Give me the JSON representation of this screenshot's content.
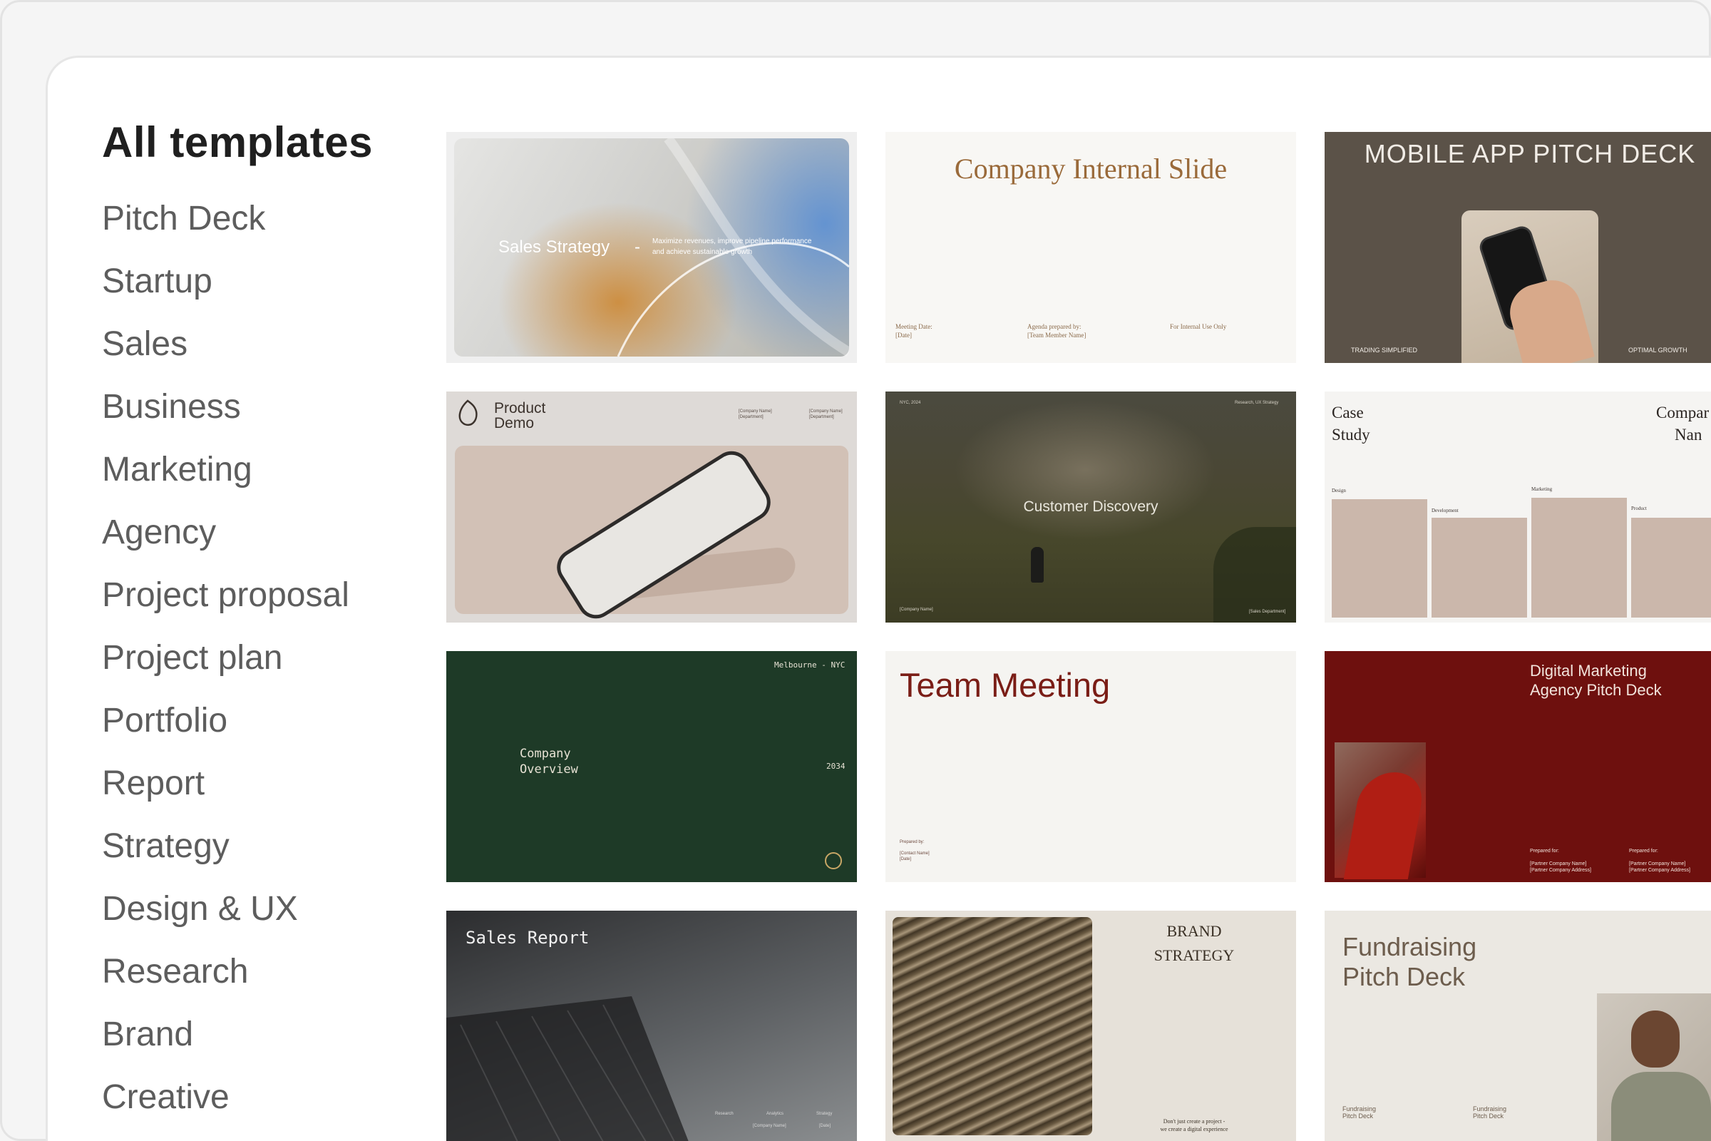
{
  "sidebar": {
    "title": "All templates",
    "categories": [
      "Pitch Deck",
      "Startup",
      "Sales",
      "Business",
      "Marketing",
      "Agency",
      "Project proposal",
      "Project plan",
      "Portfolio",
      "Report",
      "Strategy",
      "Design & UX",
      "Research",
      "Brand",
      "Creative"
    ]
  },
  "templates": {
    "sales_strategy": {
      "title": "Sales Strategy",
      "dash": "-",
      "subtitle": "Maximize revenues, improve pipeline performance and achieve sustainable growth"
    },
    "company_internal": {
      "title": "Company Internal Slide",
      "footer": [
        "Meeting Date:",
        "[Date]",
        "Agenda prepared by:",
        "[Team Member Name]",
        "For Internal Use Only"
      ]
    },
    "mobile_app": {
      "title": "MOBILE APP PITCH DECK",
      "left_caption": "TRADING SIMPLIFIED",
      "right_caption": "OPTIMAL GROWTH"
    },
    "product_demo": {
      "title_line1": "Product",
      "title_line2": "Demo",
      "meta1": [
        "[Company Name]",
        "[Department]"
      ],
      "meta2": [
        "[Company Name]",
        "[Department]"
      ]
    },
    "customer_discovery": {
      "title": "Customer Discovery",
      "top_left": "NYC, 2024",
      "top_right": "Research, UX Strategy",
      "bottom_left": "[Company Name]",
      "bottom_right": "[Sales Department]"
    },
    "case_study": {
      "title_line1": "Case",
      "title_line2": "Study",
      "company_line1": "Compar",
      "company_line2": "Nan",
      "bars": [
        "Design",
        "Development",
        "Marketing",
        "Product"
      ]
    },
    "company_overview": {
      "title_line1": "Company",
      "title_line2": "Overview",
      "location": "Melbourne - NYC",
      "year": "2034"
    },
    "team_meeting": {
      "title": "Team Meeting",
      "prepared": "Prepared by:",
      "contact": "[Contact Name]",
      "date": "[Date]"
    },
    "digital_marketing": {
      "title_line1": "Digital Marketing",
      "title_line2": "Agency Pitch Deck",
      "prepared_for": "Prepared for:",
      "partner_name": "[Partner Company Name]",
      "partner_address": "[Partner Company Address]"
    },
    "sales_report": {
      "title": "Sales Report",
      "labels": [
        "Research",
        "Analytics",
        "Strategy"
      ],
      "company": "[Company Name]",
      "date": "[Date]"
    },
    "brand_strategy": {
      "title_line1": "BRAND",
      "title_line2": "STRATEGY",
      "tagline_line1": "Don't just create a project -",
      "tagline_line2": "we create a digital experience"
    },
    "fundraising": {
      "title_line1": "Fundraising",
      "title_line2": "Pitch Deck",
      "footer_line1": "Fundraising",
      "footer_line2": "Pitch Deck"
    }
  },
  "colors": {
    "sidebar_text": "#5d5d5d",
    "heading": "#1f1f1f",
    "company_overview_bg": "#1e3a27",
    "digital_marketing_bg": "#6e100e",
    "mobile_app_bg": "#5b5248",
    "team_meeting_title": "#7a1d16",
    "company_internal_title": "#9a6a3a"
  }
}
